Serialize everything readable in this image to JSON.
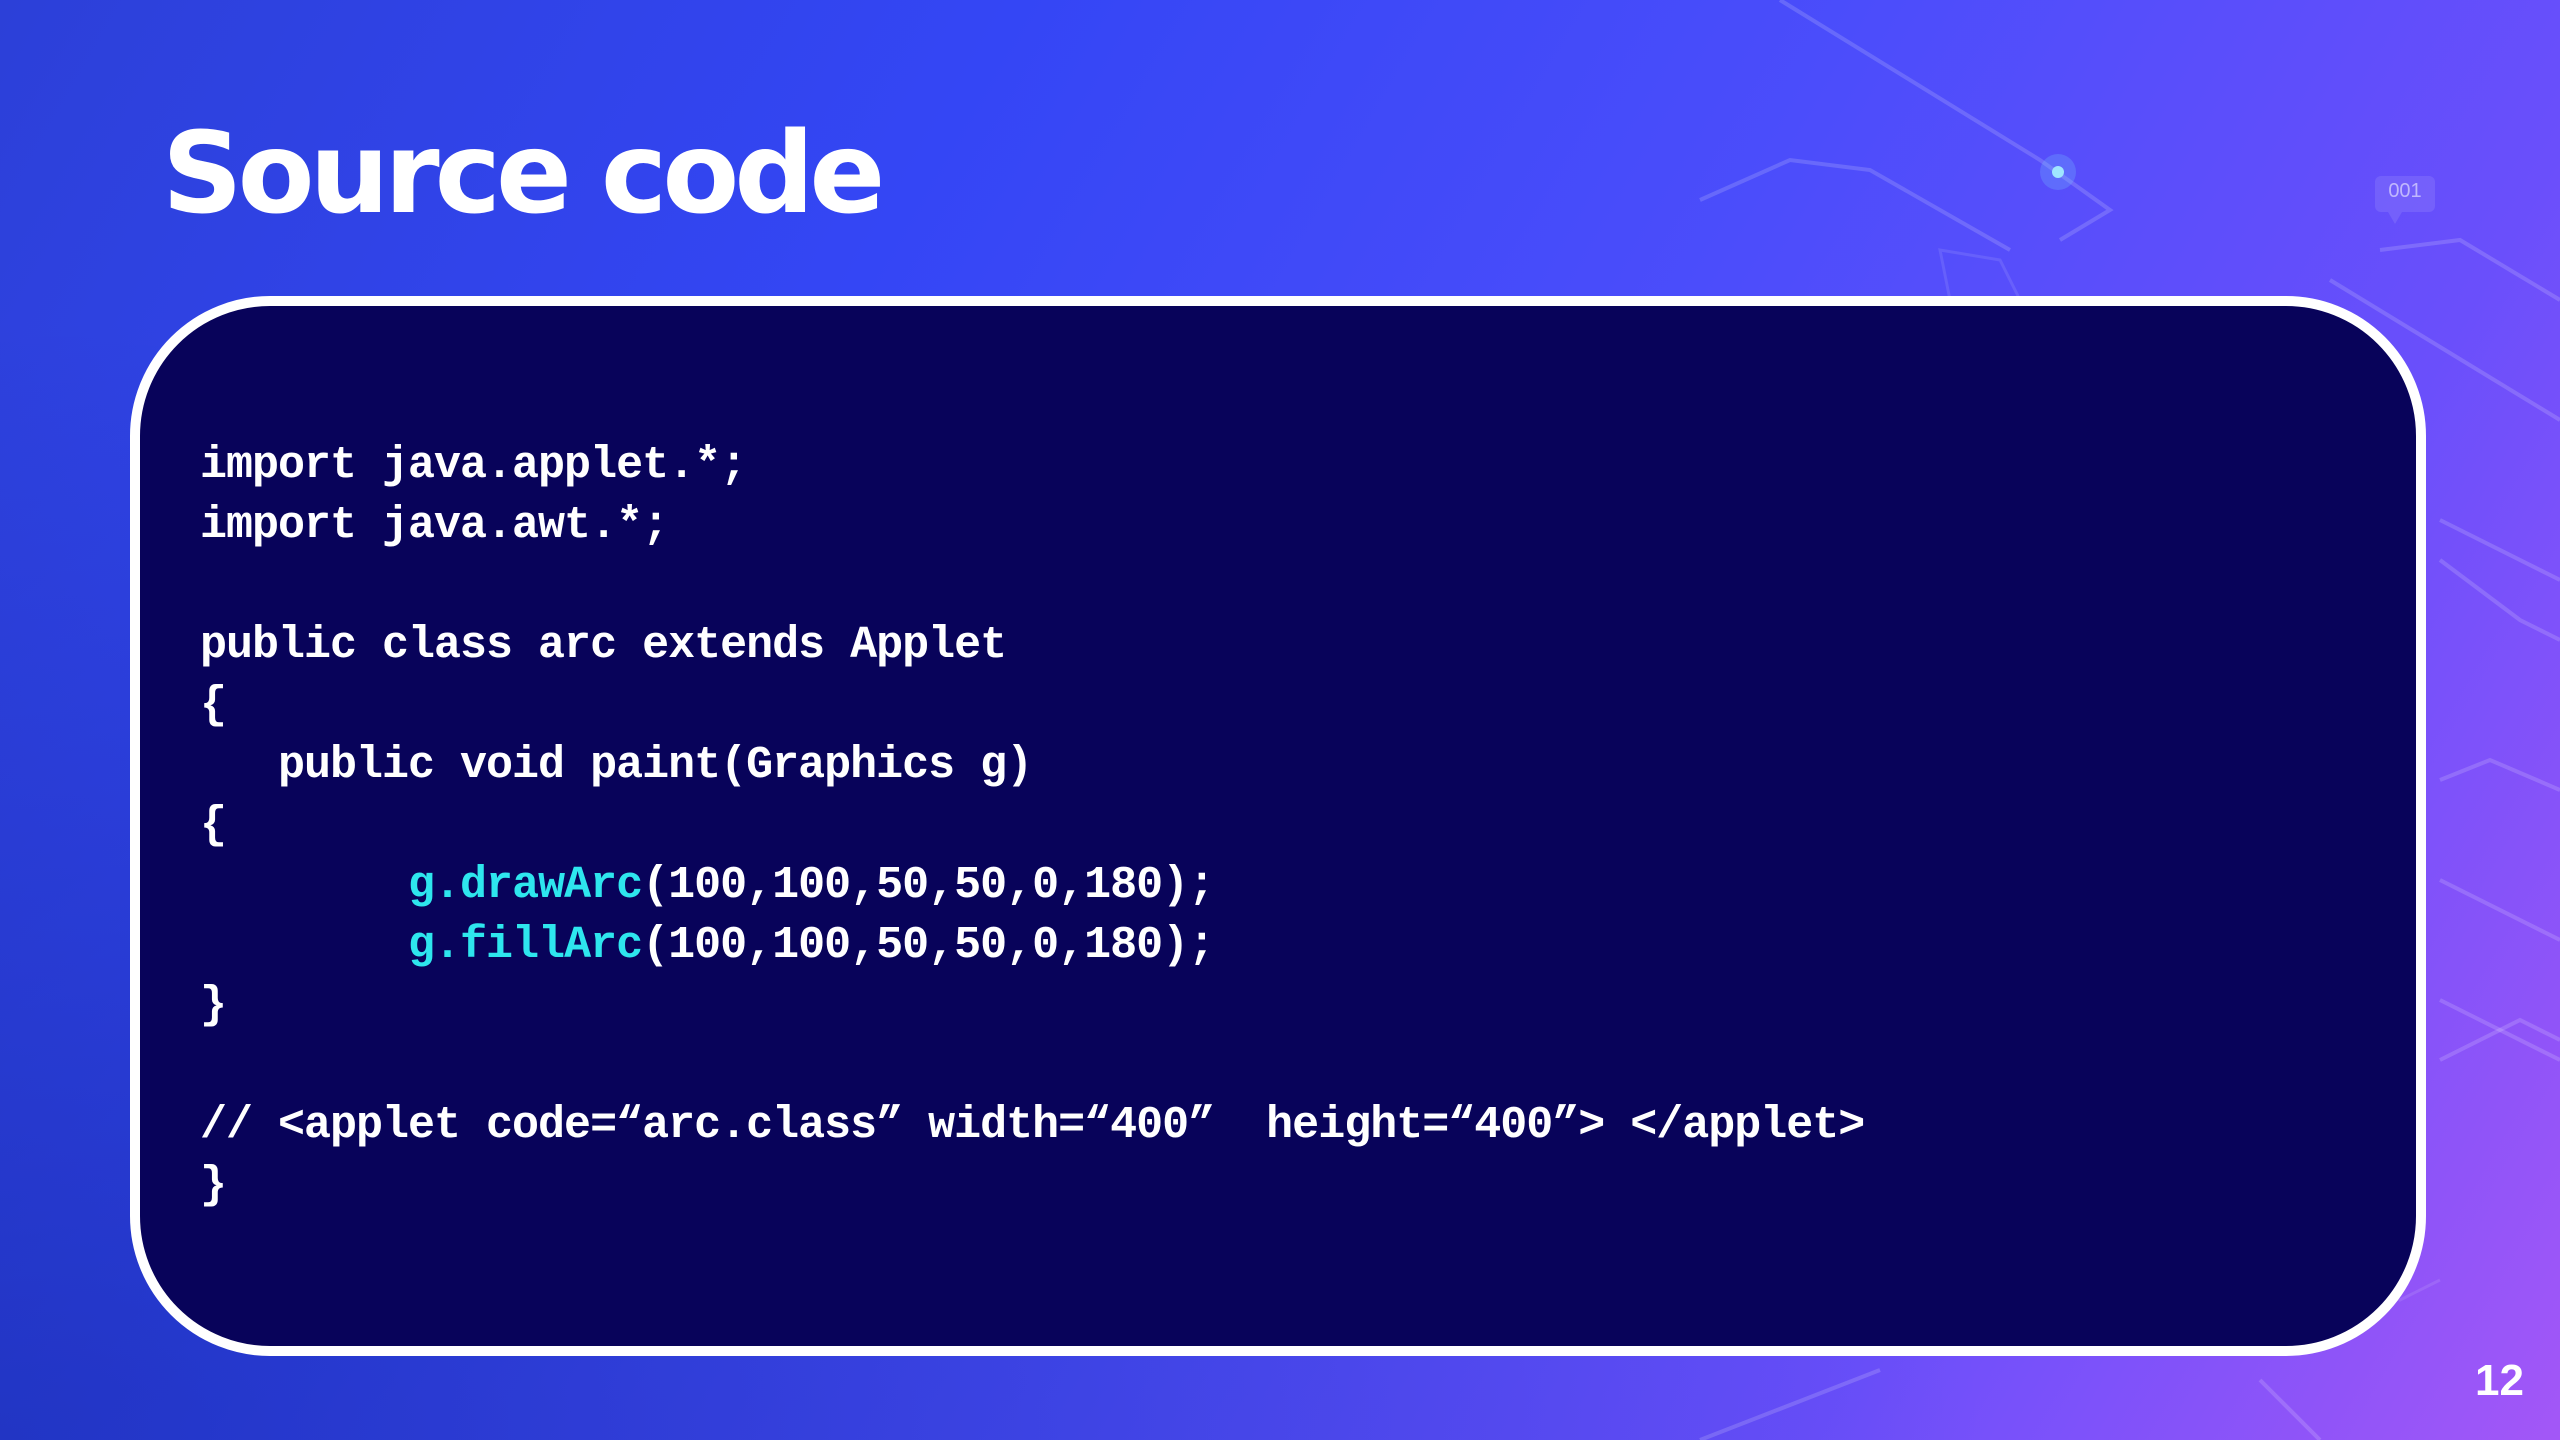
{
  "slide": {
    "title": "Source code",
    "page_number": "12",
    "decor_badge": "001"
  },
  "code": {
    "lines": [
      "import java.applet.*;",
      "import java.awt.*;",
      "",
      "public class arc extends Applet",
      "{",
      "   public void paint(Graphics g)",
      "{",
      "        g.drawArc(100,100,50,50,0,180);",
      "        g.fillArc(100,100,50,50,0,180);",
      "}",
      "",
      "// <applet code=“arc.class” width=“400”  height=“400”> </applet>",
      "}"
    ],
    "highlight": {
      "line_7_method": "g.drawArc",
      "line_7_args": "(100,100,50,50,0,180);",
      "line_8_method": "g.fillArc",
      "line_8_args": "(100,100,50,50,0,180);",
      "indent": "        "
    }
  },
  "colors": {
    "background_start": "#2c40d8",
    "background_end": "#a357f7",
    "panel_background": "#08035a",
    "panel_border": "#ffffff",
    "code_text": "#ffffff",
    "method_highlight": "#2ee6ee"
  }
}
